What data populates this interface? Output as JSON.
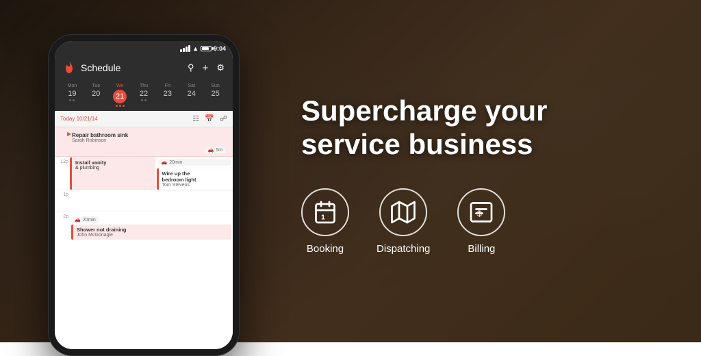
{
  "headline": {
    "line1": "Supercharge your",
    "line2": "service business"
  },
  "features": [
    {
      "id": "booking",
      "label": "Booking",
      "icon": "calendar-icon"
    },
    {
      "id": "dispatching",
      "label": "Dispatching",
      "icon": "map-icon"
    },
    {
      "id": "billing",
      "label": "Billing",
      "icon": "billing-icon"
    }
  ],
  "phone": {
    "status_time": "9:04",
    "app_title": "Schedule",
    "schedule_date": "Today 10/21/14",
    "calendar": [
      {
        "day": "Mon",
        "num": "19",
        "today": false,
        "dots": 2
      },
      {
        "day": "Tue",
        "num": "20",
        "today": false,
        "dots": 0
      },
      {
        "day": "We",
        "num": "21",
        "today": true,
        "dots": 3
      },
      {
        "day": "Thu",
        "num": "22",
        "today": false,
        "dots": 2
      },
      {
        "day": "Fri",
        "num": "23",
        "today": false,
        "dots": 0
      },
      {
        "day": "Sat",
        "num": "24",
        "today": false,
        "dots": 0
      },
      {
        "day": "Sun",
        "num": "25",
        "today": false,
        "dots": 0
      }
    ],
    "jobs": [
      {
        "time": "",
        "title": "Repair bathroom sink",
        "client": "Sarah Robinson",
        "travel": "5m",
        "active": true
      },
      {
        "time": "12p",
        "title": "Install vanity & plumbing",
        "client": "",
        "travel": "20min",
        "secondary_title": "Wire up the bedroom light",
        "secondary_client": "Tom Stevens"
      },
      {
        "time": "1p",
        "title": "",
        "client": ""
      },
      {
        "time": "2p",
        "title": "Shower not draining",
        "client": "John McGonagle",
        "travel": "20min"
      }
    ]
  }
}
